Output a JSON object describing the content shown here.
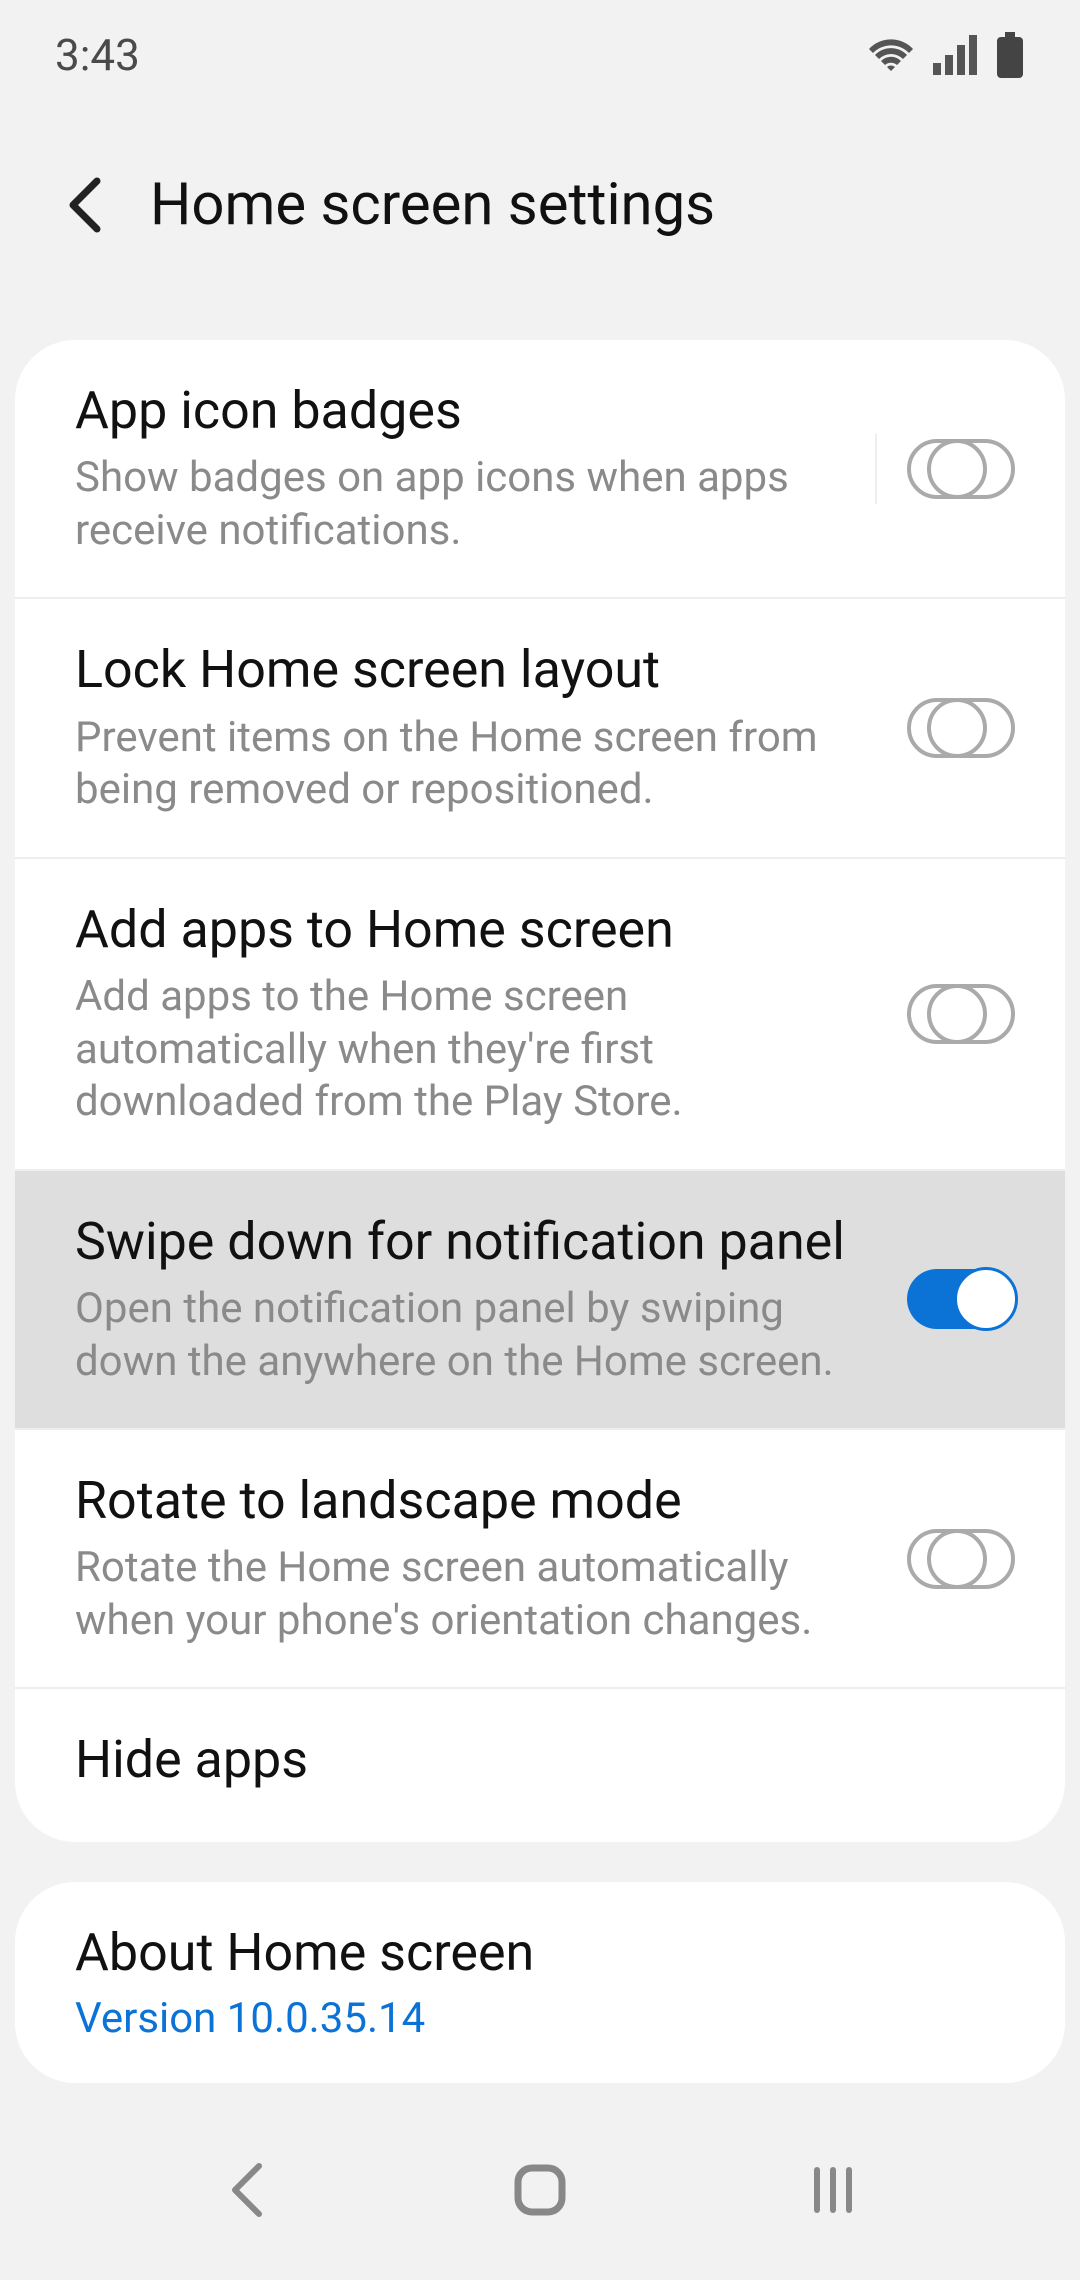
{
  "status": {
    "time": "3:43"
  },
  "header": {
    "title": "Home screen settings"
  },
  "settings": [
    {
      "id": "app-icon-badges",
      "title": "App icon badges",
      "subtitle": "Show badges on app icons when apps receive notifications.",
      "toggle": false,
      "separator": true
    },
    {
      "id": "lock-layout",
      "title": "Lock Home screen layout",
      "subtitle": "Prevent items on the Home screen from being removed or repositioned.",
      "toggle": false
    },
    {
      "id": "add-apps",
      "title": "Add apps to Home screen",
      "subtitle": "Add apps to the Home screen automatically when they're first downloaded from the Play Store.",
      "toggle": false
    },
    {
      "id": "swipe-notif",
      "title": "Swipe down for notification panel",
      "subtitle": "Open the notification panel by swiping down the anywhere on the Home screen.",
      "toggle": true,
      "highlight": true
    },
    {
      "id": "rotate",
      "title": "Rotate to landscape mode",
      "subtitle": "Rotate the Home screen automatically when your phone's orientation changes.",
      "toggle": false
    },
    {
      "id": "hide-apps",
      "title": "Hide apps"
    }
  ],
  "about": {
    "title": "About Home screen",
    "version": "Version 10.0.35.14"
  }
}
